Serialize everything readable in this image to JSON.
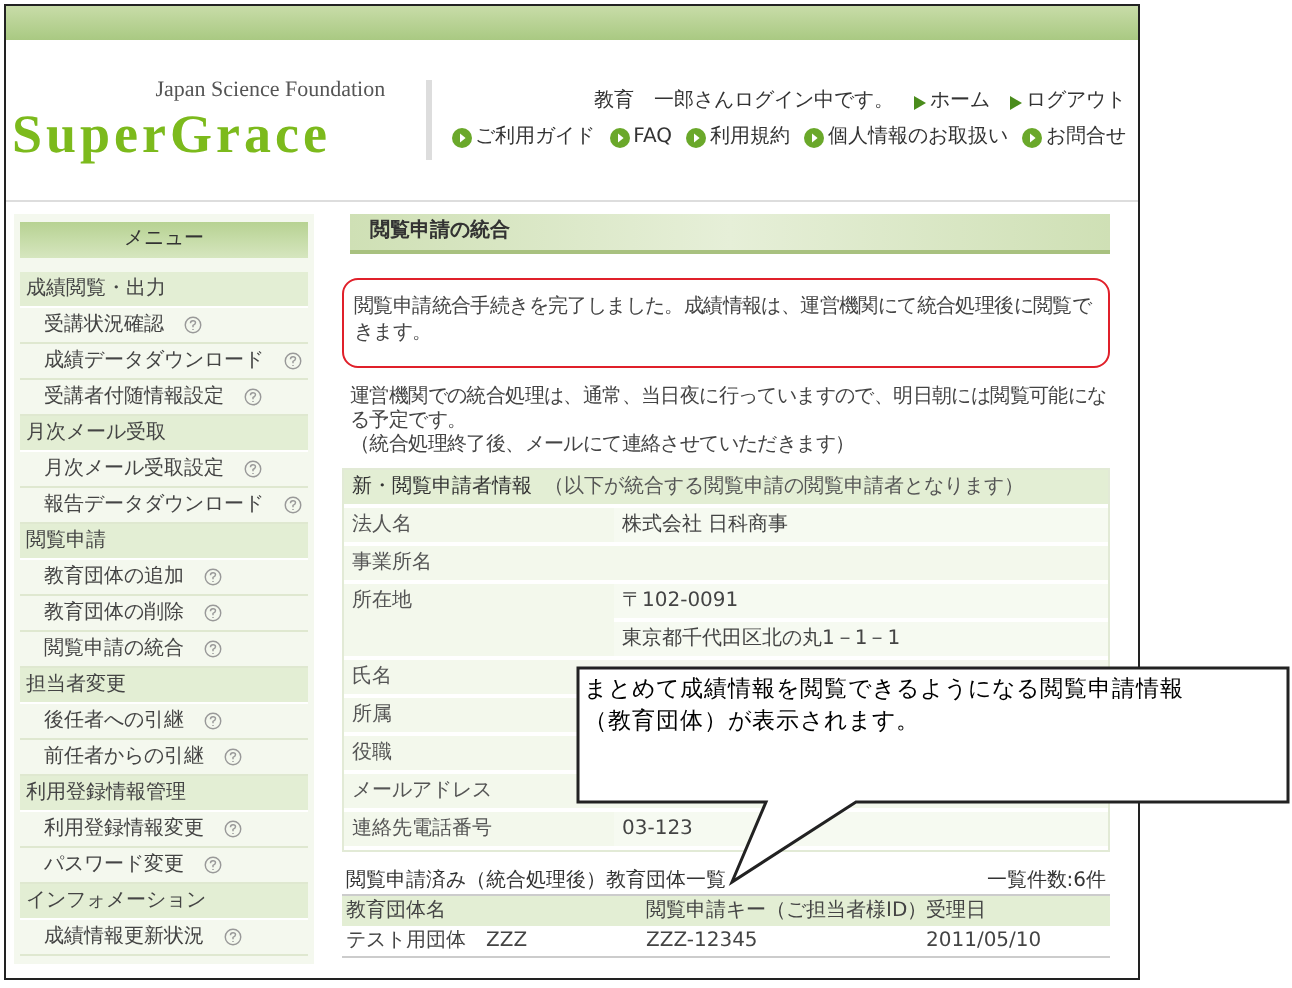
{
  "header": {
    "org_name": "Japan Science Foundation",
    "logo": "SuperGrace",
    "user_status": "教育　一郎さんログイン中です。",
    "nav_links": [
      {
        "label": "ホーム"
      },
      {
        "label": "ログアウト"
      }
    ],
    "util_links": [
      {
        "label": "ご利用ガイド"
      },
      {
        "label": "FAQ"
      },
      {
        "label": "利用規約"
      },
      {
        "label": "個人情報のお取扱い"
      },
      {
        "label": "お問合せ"
      }
    ]
  },
  "sidebar": {
    "title": "メニュー",
    "sections": [
      {
        "label": "成績閲覧・出力",
        "items": [
          {
            "label": "受講状況確認"
          },
          {
            "label": "成績データダウンロード"
          },
          {
            "label": "受講者付随情報設定"
          }
        ]
      },
      {
        "label": "月次メール受取",
        "items": [
          {
            "label": "月次メール受取設定"
          },
          {
            "label": "報告データダウンロード"
          }
        ]
      },
      {
        "label": "閲覧申請",
        "items": [
          {
            "label": "教育団体の追加"
          },
          {
            "label": "教育団体の削除"
          },
          {
            "label": "閲覧申請の統合"
          }
        ]
      },
      {
        "label": "担当者変更",
        "items": [
          {
            "label": "後任者への引継"
          },
          {
            "label": "前任者からの引継"
          }
        ]
      },
      {
        "label": "利用登録情報管理",
        "items": [
          {
            "label": "利用登録情報変更"
          },
          {
            "label": "パスワード変更"
          }
        ]
      },
      {
        "label": "インフォメーション",
        "items": [
          {
            "label": "成績情報更新状況"
          }
        ]
      }
    ]
  },
  "page_title": "閲覧申請の統合",
  "message": "閲覧申請統合手続きを完了しました。成績情報は、運営機関にて統合処理後に閲覧できます。",
  "note_lines": [
    "運営機関での統合処理は、通常、当日夜に行っていますので、明日朝には閲覧可能になる予定です。",
    "（統合処理終了後、メールにて連絡させていただきます）"
  ],
  "applicant_info": {
    "title": "新・閲覧申請者情報",
    "subtitle": "（以下が統合する閲覧申請の閲覧申請者となります）",
    "rows": [
      {
        "label": "法人名",
        "values": [
          "株式会社 日科商事"
        ]
      },
      {
        "label": "事業所名",
        "values": []
      },
      {
        "label": "所在地",
        "values": [
          "〒102-0091",
          "東京都千代田区北の丸1－1－1"
        ]
      },
      {
        "label": "氏名",
        "values": []
      },
      {
        "label": "所属",
        "values": []
      },
      {
        "label": "役職",
        "values": []
      },
      {
        "label": "メールアドレス",
        "values": []
      },
      {
        "label": "連絡先電話番号",
        "values": [
          "03-123"
        ]
      }
    ]
  },
  "org_list": {
    "title": "閲覧申請済み（統合処理後）教育団体一覧",
    "count": "一覧件数:6件",
    "columns": [
      "教育団体名",
      "閲覧申請キー（ご担当者様ID）",
      "受理日"
    ],
    "rows": [
      [
        "テスト用団体　ZZZ",
        "ZZZ-12345",
        "2011/05/10"
      ]
    ]
  },
  "callout": {
    "lines": [
      "まとめて成績情報を閲覧できるようになる閲覧申請情報",
      "（教育団体）が表示されます。"
    ]
  }
}
